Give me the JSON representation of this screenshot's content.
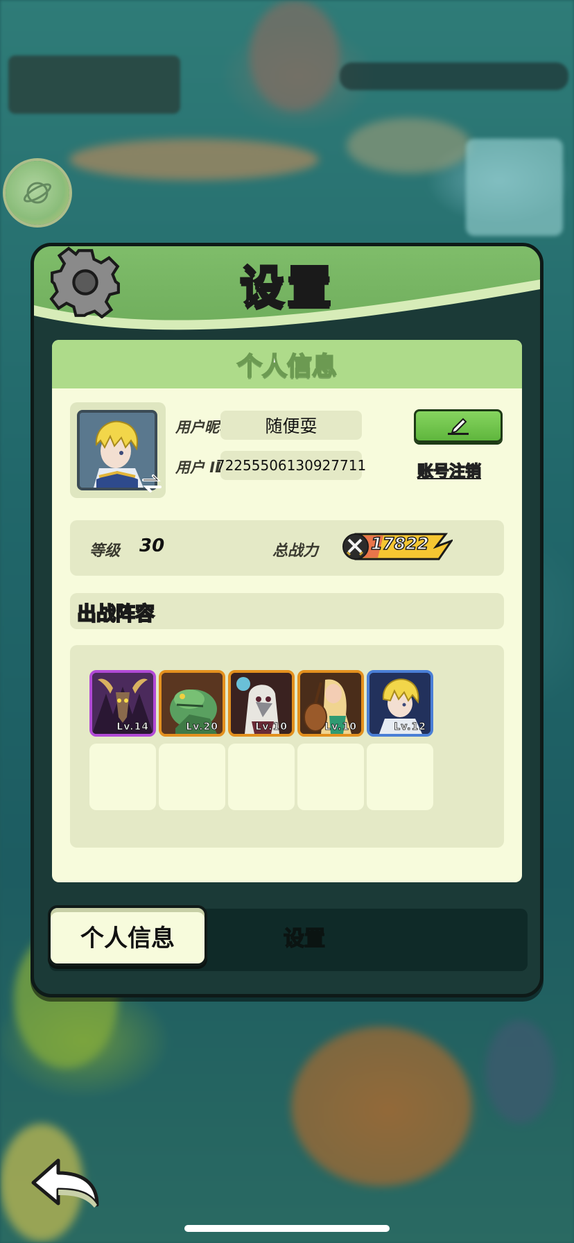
{
  "dialog": {
    "title": "设置"
  },
  "profile": {
    "section_title": "个人信息",
    "nickname_label": "用户昵称",
    "nickname_value": "随便耍",
    "id_label": "用户 ID",
    "id_value": "72255506130927711",
    "logout_label": "账号注销"
  },
  "stats": {
    "level_label": "等级",
    "level_value": "30",
    "power_label": "总战力",
    "power_value": "17822"
  },
  "lineup": {
    "title": "出战阵容",
    "heroes": [
      {
        "name": "goat-demon",
        "level": "Lv.14",
        "rarity": "purple"
      },
      {
        "name": "lizard",
        "level": "Lv.20",
        "rarity": "orange"
      },
      {
        "name": "plague-doctor",
        "level": "Lv.10",
        "rarity": "orange"
      },
      {
        "name": "bard",
        "level": "Lv.10",
        "rarity": "orange"
      },
      {
        "name": "blonde-knight",
        "level": "Lv.12",
        "rarity": "blue"
      }
    ],
    "empty_slots": 5
  },
  "tabs": {
    "active": "个人信息",
    "inactive": "设置"
  },
  "colors": {
    "header_green": "#7fbd6a",
    "panel_bg": "#f7fbdc",
    "power_yellow": "#f6c632"
  }
}
